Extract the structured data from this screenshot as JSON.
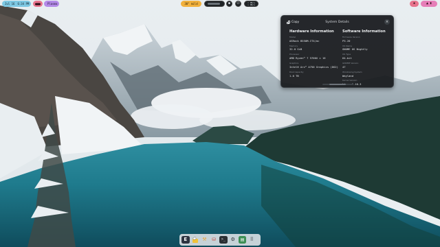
{
  "topbar": {
    "clock": {
      "date": "Jul 16",
      "time": "6:34 PM"
    },
    "workspace_name": "Plasma",
    "weather": "30° mild",
    "network": {
      "up": "↑ 0B/s",
      "down": "↓ 0B/s"
    },
    "accent_color": "#e7738c",
    "clock_color": "#7ec8e3"
  },
  "window": {
    "title": "System Details",
    "copy_label": "Copy",
    "close_icon": "close-icon",
    "hardware": {
      "heading": "Hardware Information",
      "fields": [
        {
          "label": "Model",
          "value": "ASRock B550M-ITX/ac"
        },
        {
          "label": "Memory",
          "value": "32.0 GiB"
        },
        {
          "label": "Processor",
          "value": "AMD Ryzen™ 7 5700X × 16"
        },
        {
          "label": "Graphics",
          "value": "Intel® Arc™ A750 Graphics (DG2)"
        },
        {
          "label": "Disk Capacity",
          "value": "1.0 TB"
        }
      ]
    },
    "software": {
      "heading": "Software Information",
      "fields": [
        {
          "label": "Firmware Version",
          "value": "P3.20"
        },
        {
          "label": "OS Name",
          "value": "GNOME OS Nightly"
        },
        {
          "label": "OS Type",
          "value": "64-bit"
        },
        {
          "label": "GNOME Version",
          "value": "47"
        },
        {
          "label": "Windowing System",
          "value": "Wayland"
        },
        {
          "label": "Kernel Version",
          "value": "Linux 6.10.3"
        }
      ]
    }
  },
  "dock": {
    "items": [
      {
        "name": "app-launcher-icon",
        "glyph": "E"
      },
      {
        "name": "files-icon",
        "glyph": "🗂"
      },
      {
        "name": "builder-icon",
        "glyph": "⚒"
      },
      {
        "name": "disks-icon",
        "glyph": "⛁"
      },
      {
        "name": "terminal-icon",
        "glyph": ">_"
      },
      {
        "name": "settings-icon",
        "glyph": "⚙"
      },
      {
        "name": "text-editor-icon",
        "glyph": "▤"
      },
      {
        "name": "app-grid-icon",
        "glyph": "⠿"
      }
    ]
  }
}
